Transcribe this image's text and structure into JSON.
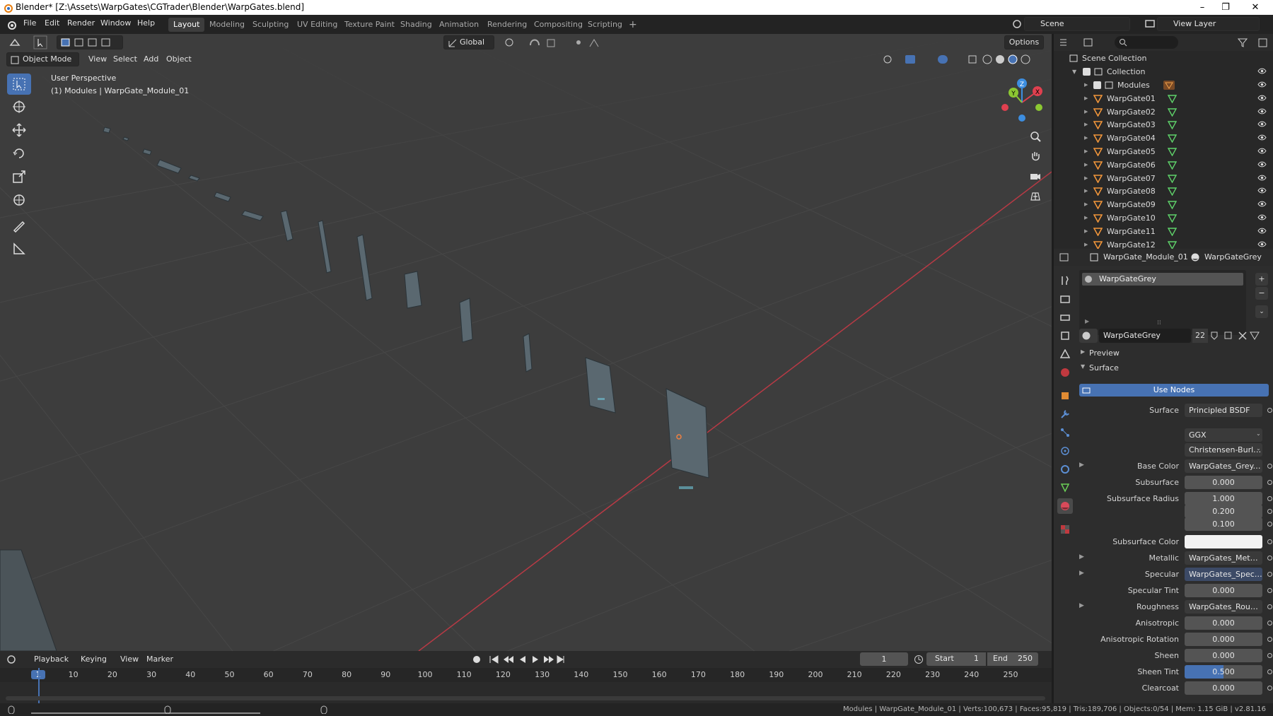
{
  "window": {
    "title": "Blender* [Z:\\Assets\\WarpGates\\CGTrader\\Blender\\WarpGates.blend]",
    "controls": [
      "–",
      "❐",
      "✕"
    ]
  },
  "menu": [
    "File",
    "Edit",
    "Render",
    "Window",
    "Help"
  ],
  "workspaces": [
    {
      "label": "Layout",
      "active": true
    },
    {
      "label": "Modeling"
    },
    {
      "label": "Sculpting"
    },
    {
      "label": "UV Editing"
    },
    {
      "label": "Texture Paint"
    },
    {
      "label": "Shading"
    },
    {
      "label": "Animation"
    },
    {
      "label": "Rendering"
    },
    {
      "label": "Compositing"
    },
    {
      "label": "Scripting"
    }
  ],
  "add_workspace": "+",
  "scene": {
    "label": "Scene",
    "view_layer": "View Layer"
  },
  "viewport": {
    "orientation": "Global",
    "options": "Options",
    "mode": "Object Mode",
    "header_menus": [
      "View",
      "Select",
      "Add",
      "Object"
    ],
    "overlay_title": "User Perspective",
    "overlay_subtitle": "(1) Modules | WarpGate_Module_01",
    "gizmo_axes": [
      "Z",
      "Y",
      "X"
    ]
  },
  "tools": [
    "select-box",
    "cursor",
    "move",
    "rotate",
    "scale",
    "transform",
    "annotate",
    "measure"
  ],
  "outliner": {
    "root": "Scene Collection",
    "collection": "Collection",
    "items": [
      {
        "name": "Modules",
        "type": "collection"
      },
      {
        "name": "WarpGate01"
      },
      {
        "name": "WarpGate02"
      },
      {
        "name": "WarpGate03"
      },
      {
        "name": "WarpGate04"
      },
      {
        "name": "WarpGate05"
      },
      {
        "name": "WarpGate06"
      },
      {
        "name": "WarpGate07"
      },
      {
        "name": "WarpGate08"
      },
      {
        "name": "WarpGate09"
      },
      {
        "name": "WarpGate10"
      },
      {
        "name": "WarpGate11"
      },
      {
        "name": "WarpGate12"
      }
    ]
  },
  "properties": {
    "object_name": "WarpGate_Module_01",
    "material_name": "WarpGateGrey",
    "slot_name": "WarpGateGrey",
    "material_users": "22",
    "panels": {
      "preview": "Preview",
      "surface": "Surface"
    },
    "use_nodes": "Use Nodes",
    "fields": [
      {
        "label": "Surface",
        "value": "Principled BSDF",
        "kind": "text"
      },
      {
        "label": "",
        "value": "GGX",
        "kind": "dropdown"
      },
      {
        "label": "",
        "value": "Christensen-Burley",
        "kind": "dropdown"
      },
      {
        "label": "Base Color",
        "value": "WarpGates_Grey.png",
        "kind": "text",
        "expand": true
      },
      {
        "label": "Subsurface",
        "value": "0.000",
        "kind": "num"
      },
      {
        "label": "Subsurface Radius",
        "value": "1.000",
        "kind": "num"
      },
      {
        "label": "",
        "value": "0.200",
        "kind": "num"
      },
      {
        "label": "",
        "value": "0.100",
        "kind": "num"
      },
      {
        "label": "Subsurface Color",
        "value": "",
        "kind": "color"
      },
      {
        "label": "Metallic",
        "value": "WarpGates_Metallic...",
        "kind": "text",
        "expand": true
      },
      {
        "label": "Specular",
        "value": "WarpGates_Specular...",
        "kind": "text",
        "expand": true,
        "highlight": true
      },
      {
        "label": "Specular Tint",
        "value": "0.000",
        "kind": "num"
      },
      {
        "label": "Roughness",
        "value": "WarpGates_Roughne...",
        "kind": "text",
        "expand": true
      },
      {
        "label": "Anisotropic",
        "value": "0.000",
        "kind": "num"
      },
      {
        "label": "Anisotropic Rotation",
        "value": "0.000",
        "kind": "num"
      },
      {
        "label": "Sheen",
        "value": "0.000",
        "kind": "num"
      },
      {
        "label": "Sheen Tint",
        "value": "0.500",
        "kind": "slider",
        "fraction": 0.5
      },
      {
        "label": "Clearcoat",
        "value": "0.000",
        "kind": "num"
      }
    ]
  },
  "timeline": {
    "menus": [
      "Playback",
      "Keying",
      "View",
      "Marker"
    ],
    "current_frame": "1",
    "start_label": "Start",
    "start": "1",
    "end_label": "End",
    "end": "250",
    "ticks": [
      "1",
      "10",
      "20",
      "30",
      "40",
      "50",
      "60",
      "70",
      "80",
      "90",
      "100",
      "110",
      "120",
      "130",
      "140",
      "150",
      "160",
      "170",
      "180",
      "190",
      "200",
      "210",
      "220",
      "230",
      "240",
      "250"
    ]
  },
  "status": "Modules | WarpGate_Module_01 | Verts:100,673 | Faces:95,819 | Tris:189,706 | Objects:0/54 | Mem: 1.15 GiB | v2.81.16",
  "colors": {
    "accent": "#4772b3",
    "x_axis": "#e0404f",
    "y_axis": "#8cc832",
    "z_axis": "#3d8ee0"
  }
}
